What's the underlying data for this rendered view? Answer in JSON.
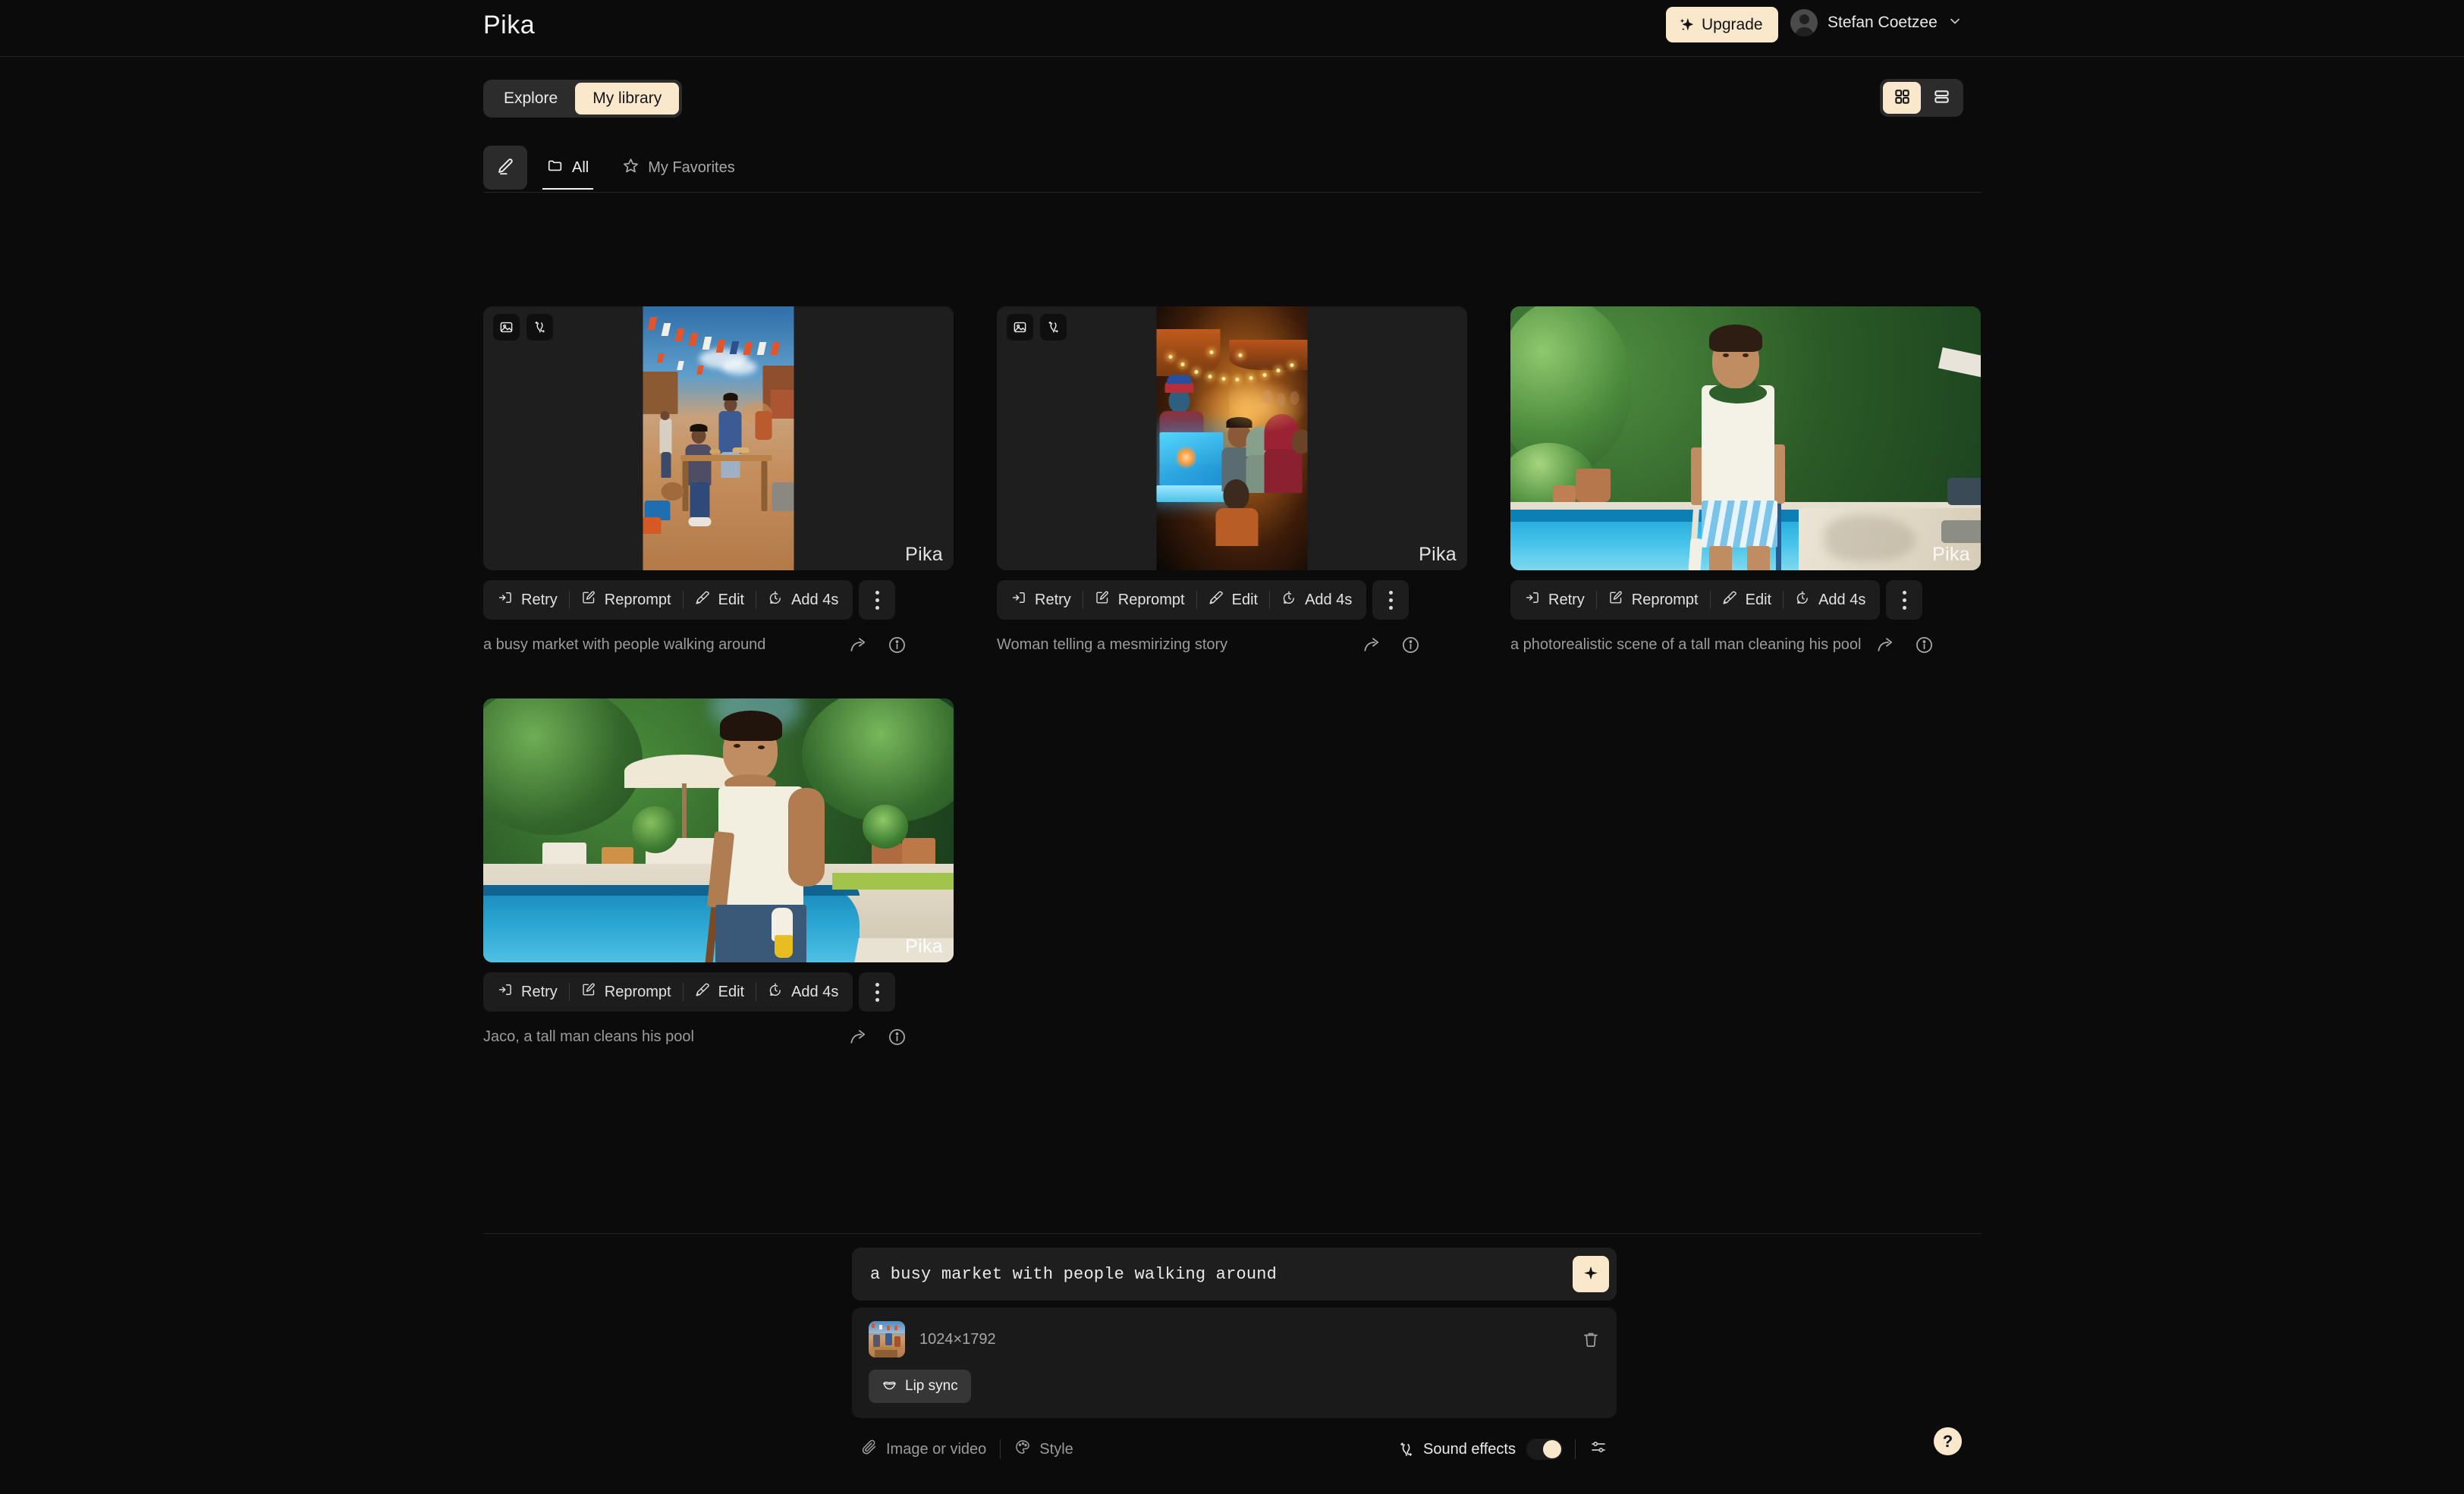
{
  "app": {
    "brand": "Pika",
    "upgrade_label": "Upgrade",
    "user_name": "Stefan Coetzee"
  },
  "tabs": {
    "explore": "Explore",
    "my_library": "My library",
    "active": "My library"
  },
  "view_toggle": {
    "grid_label": "grid-view",
    "list_label": "list-view",
    "active": "grid"
  },
  "filters": {
    "all": "All",
    "favorites": "My Favorites",
    "active": "All"
  },
  "actions": {
    "retry": "Retry",
    "reprompt": "Reprompt",
    "edit": "Edit",
    "add": "Add 4s"
  },
  "cards": [
    {
      "caption": "a busy market with people walking around",
      "watermark": "Pika",
      "layout": "portrait",
      "scene": "market",
      "badges": [
        "image-icon",
        "sound-wave-icon"
      ]
    },
    {
      "caption": "Woman telling a mesmirizing story",
      "watermark": "Pika",
      "layout": "portrait",
      "scene": "night",
      "badges": [
        "image-icon",
        "sound-wave-icon"
      ]
    },
    {
      "caption": "a photorealistic scene of a tall man cleaning his pool",
      "watermark": "Pika",
      "layout": "full",
      "scene": "pool-standing",
      "badges": []
    },
    {
      "caption": "Jaco, a tall man cleans his pool",
      "watermark": "Pika",
      "layout": "full",
      "scene": "pool-cleaning",
      "badges": []
    }
  ],
  "composer": {
    "prompt_value": "a busy market with people walking around",
    "attachment_dimensions": "1024×1792",
    "lip_sync_label": "Lip sync",
    "image_or_video_label": "Image or video",
    "style_label": "Style",
    "sound_effects_label": "Sound effects",
    "sound_effects_on": true,
    "help_label": "?"
  },
  "colors": {
    "accent_cream": "#fae8cd",
    "page_background": "#0b0b0b",
    "card_background": "#1e1e1e",
    "toolbar_background": "#1d1d1d"
  }
}
